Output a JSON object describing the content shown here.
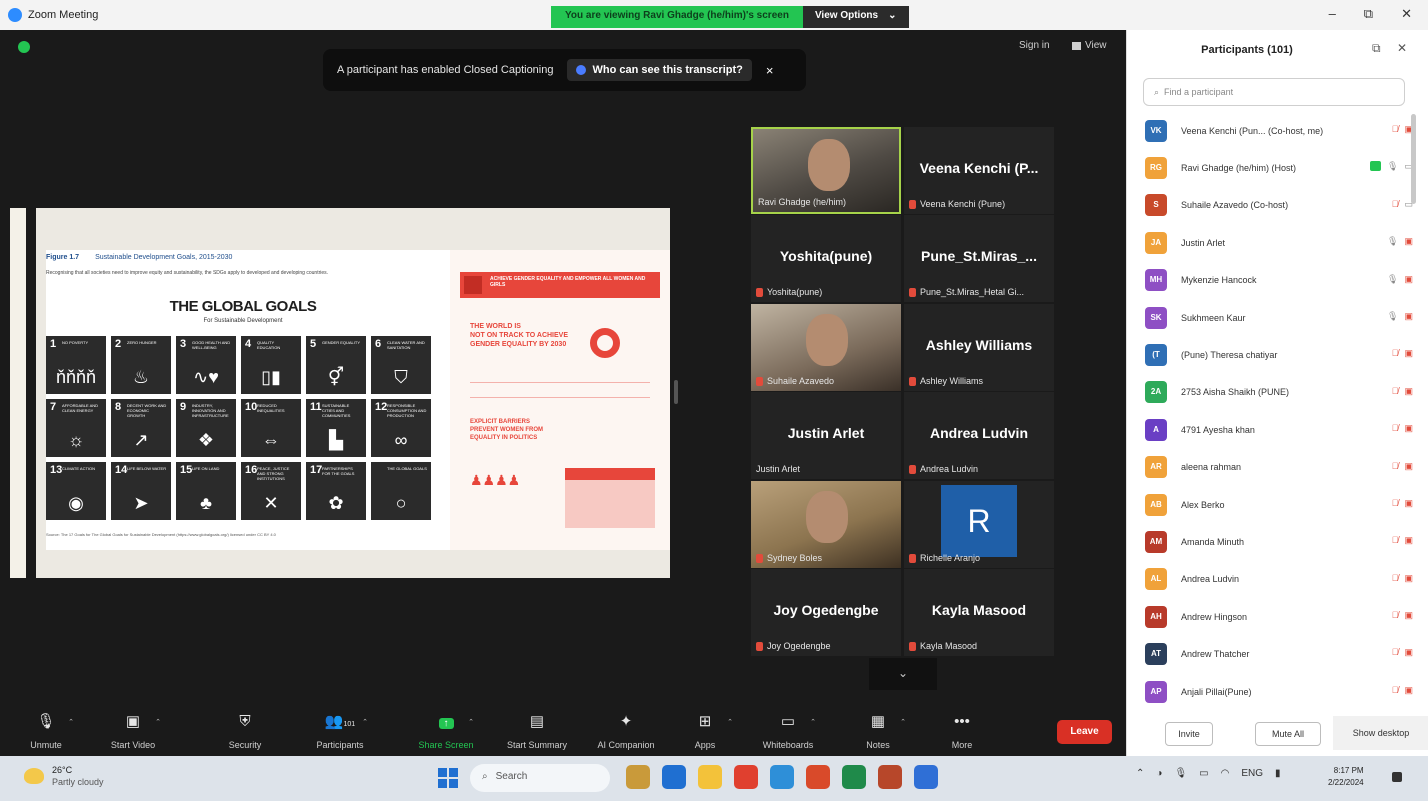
{
  "window": {
    "title": "Zoom Meeting",
    "minimize": "–",
    "maximize": "⧉",
    "close": "✕"
  },
  "share_banner": {
    "message": "You are viewing Ravi Ghadge (he/him)'s screen",
    "view_options": "View Options",
    "caret": "⌄"
  },
  "meeting": {
    "sign_in": "Sign in",
    "view": "View"
  },
  "caption_bar": {
    "message": "A participant has enabled Closed Captioning",
    "button": "Who can see this transcript?",
    "close": "×"
  },
  "slide": {
    "figure_label": "Figure 1.7",
    "figure_title": "Sustainable Development Goals, 2015-2030",
    "intro": "Recognising that all societies need to improve equity and sustainability, the SDGs apply to developed and developing countries.",
    "title": "THE GLOBAL GOALS",
    "subtitle": "For Sustainable Development",
    "source": "Source: The 17 Goals for The Global Goals for Sustainable Development (https://www.globalgoals.org/) licensed under CC BY 4.0",
    "goals": [
      {
        "n": "1",
        "label": "NO POVERTY",
        "glyph": "ňňňň"
      },
      {
        "n": "2",
        "label": "ZERO HUNGER",
        "glyph": "♨"
      },
      {
        "n": "3",
        "label": "GOOD HEALTH AND WELL-BEING",
        "glyph": "∿♥"
      },
      {
        "n": "4",
        "label": "QUALITY EDUCATION",
        "glyph": "▯▮"
      },
      {
        "n": "5",
        "label": "GENDER EQUALITY",
        "glyph": "⚥"
      },
      {
        "n": "6",
        "label": "CLEAN WATER AND SANITATION",
        "glyph": "⛉"
      },
      {
        "n": "7",
        "label": "AFFORDABLE AND CLEAN ENERGY",
        "glyph": "☼"
      },
      {
        "n": "8",
        "label": "DECENT WORK AND ECONOMIC GROWTH",
        "glyph": "↗"
      },
      {
        "n": "9",
        "label": "INDUSTRY, INNOVATION AND INFRASTRUCTURE",
        "glyph": "❖"
      },
      {
        "n": "10",
        "label": "REDUCED INEQUALITIES",
        "glyph": "⇔"
      },
      {
        "n": "11",
        "label": "SUSTAINABLE CITIES AND COMMUNITIES",
        "glyph": "▙"
      },
      {
        "n": "12",
        "label": "RESPONSIBLE CONSUMPTION AND PRODUCTION",
        "glyph": "∞"
      },
      {
        "n": "13",
        "label": "CLIMATE ACTION",
        "glyph": "◉"
      },
      {
        "n": "14",
        "label": "LIFE BELOW WATER",
        "glyph": "➤"
      },
      {
        "n": "15",
        "label": "LIFE ON LAND",
        "glyph": "♣"
      },
      {
        "n": "16",
        "label": "PEACE, JUSTICE AND STRONG INSTITUTIONS",
        "glyph": "✕"
      },
      {
        "n": "17",
        "label": "PARTNERSHIPS FOR THE GOALS",
        "glyph": "✿"
      },
      {
        "n": "",
        "label": "THE GLOBAL GOALS",
        "glyph": "○"
      }
    ],
    "infographic": {
      "header": "ACHIEVE GENDER EQUALITY AND EMPOWER ALL WOMEN AND GIRLS",
      "line1": "THE WORLD IS",
      "line2": "NOT ON TRACK TO ACHIEVE",
      "line3": "GENDER EQUALITY BY 2030",
      "line4": "EXPLICIT BARRIERS",
      "line5": "PREVENT WOMEN FROM",
      "line6": "EQUALITY IN POLITICS"
    }
  },
  "gallery": [
    {
      "big": "",
      "name": "Ravi Ghadge (he/him)",
      "video": true,
      "muted": false
    },
    {
      "big": "Veena Kenchi (P...",
      "name": "Veena Kenchi (Pune)",
      "video": false,
      "muted": true
    },
    {
      "big": "Yoshita(pune)",
      "name": "Yoshita(pune)",
      "video": false,
      "muted": true
    },
    {
      "big": "Pune_St.Miras_...",
      "name": "Pune_St.Miras_Hetal Gi...",
      "video": false,
      "muted": true
    },
    {
      "big": "",
      "name": "Suhaile Azavedo",
      "video": true,
      "muted": true
    },
    {
      "big": "Ashley Williams",
      "name": "Ashley Williams",
      "video": false,
      "muted": true
    },
    {
      "big": "Justin Arlet",
      "name": "Justin Arlet",
      "video": false,
      "muted": false
    },
    {
      "big": "Andrea Ludvin",
      "name": "Andrea Ludvin",
      "video": false,
      "muted": true
    },
    {
      "big": "",
      "name": "Sydney Boles",
      "video": true,
      "muted": true
    },
    {
      "big": "R",
      "name": "Richelle Aranjo",
      "video": false,
      "muted": true
    },
    {
      "big": "Joy Ogedengbe",
      "name": "Joy Ogedengbe",
      "video": false,
      "muted": true
    },
    {
      "big": "Kayla Masood",
      "name": "Kayla Masood",
      "video": false,
      "muted": true
    }
  ],
  "gallery_down": "⌄",
  "toolbar": {
    "unmute": "Unmute",
    "start_video": "Start Video",
    "security": "Security",
    "participants": "Participants",
    "participants_count": "101",
    "share_screen": "Share Screen",
    "start_summary": "Start Summary",
    "ai_companion": "AI Companion",
    "apps": "Apps",
    "whiteboards": "Whiteboards",
    "notes": "Notes",
    "more": "More",
    "leave": "Leave"
  },
  "panel": {
    "title": "Participants (101)",
    "search_placeholder": "Find a participant",
    "participants": [
      {
        "initials": "VK",
        "color": "#2f6fb5",
        "name": "Veena Kenchi (Pun... (Co-host, me)",
        "muted": true,
        "video_off": true
      },
      {
        "initials": "RG",
        "color": "#f0a23a",
        "name": "Ravi Ghadge (he/him) (Host)",
        "muted": false,
        "video_off": false,
        "sharing": true
      },
      {
        "initials": "S",
        "color": "#c84a2a",
        "name": "Suhaile Azavedo (Co-host)",
        "muted": true,
        "video_off": false
      },
      {
        "initials": "JA",
        "color": "#f0a23a",
        "name": "Justin Arlet",
        "muted": false,
        "video_off": true
      },
      {
        "initials": "MH",
        "color": "#8e4fc4",
        "name": "Mykenzie Hancock",
        "muted": false,
        "video_off": true
      },
      {
        "initials": "SK",
        "color": "#8e4fc4",
        "name": "Sukhmeen Kaur",
        "muted": false,
        "video_off": true
      },
      {
        "initials": "(T",
        "color": "#2f6fb5",
        "name": "(Pune) Theresa chatiyar",
        "muted": true,
        "video_off": true
      },
      {
        "initials": "2A",
        "color": "#2eaa5a",
        "name": "2753 Aisha Shaikh (PUNE)",
        "muted": true,
        "video_off": true
      },
      {
        "initials": "A",
        "color": "#6a3fc4",
        "name": "4791 Ayesha khan",
        "muted": true,
        "video_off": true
      },
      {
        "initials": "AR",
        "color": "#f0a23a",
        "name": "aleena rahman",
        "muted": true,
        "video_off": true
      },
      {
        "initials": "AB",
        "color": "#f0a23a",
        "name": "Alex Berko",
        "muted": true,
        "video_off": true
      },
      {
        "initials": "AM",
        "color": "#b83a2a",
        "name": "Amanda Minuth",
        "muted": true,
        "video_off": true
      },
      {
        "initials": "AL",
        "color": "#f0a23a",
        "name": "Andrea Ludvin",
        "muted": true,
        "video_off": true
      },
      {
        "initials": "AH",
        "color": "#b83a2a",
        "name": "Andrew Hingson",
        "muted": true,
        "video_off": true
      },
      {
        "initials": "AT",
        "color": "#2b3f5c",
        "name": "Andrew Thatcher",
        "muted": true,
        "video_off": true
      },
      {
        "initials": "AP",
        "color": "#8e4fc4",
        "name": "Anjali Pillai(Pune)",
        "muted": true,
        "video_off": true
      }
    ],
    "invite": "Invite",
    "mute_all": "Mute All",
    "show_desktop": "Show desktop"
  },
  "taskbar": {
    "temp": "26°C",
    "weather": "Partly cloudy",
    "search": "Search",
    "time": "8:17 PM",
    "date": "2/22/2024",
    "tray_lang": "ENG",
    "apps": [
      "#c99a3a",
      "#1f6fd1",
      "#f3c23a",
      "#e0402f",
      "#2e8fd8",
      "#d94a2a",
      "#1f8a4a",
      "#b7472a",
      "#2f6fd6"
    ]
  }
}
